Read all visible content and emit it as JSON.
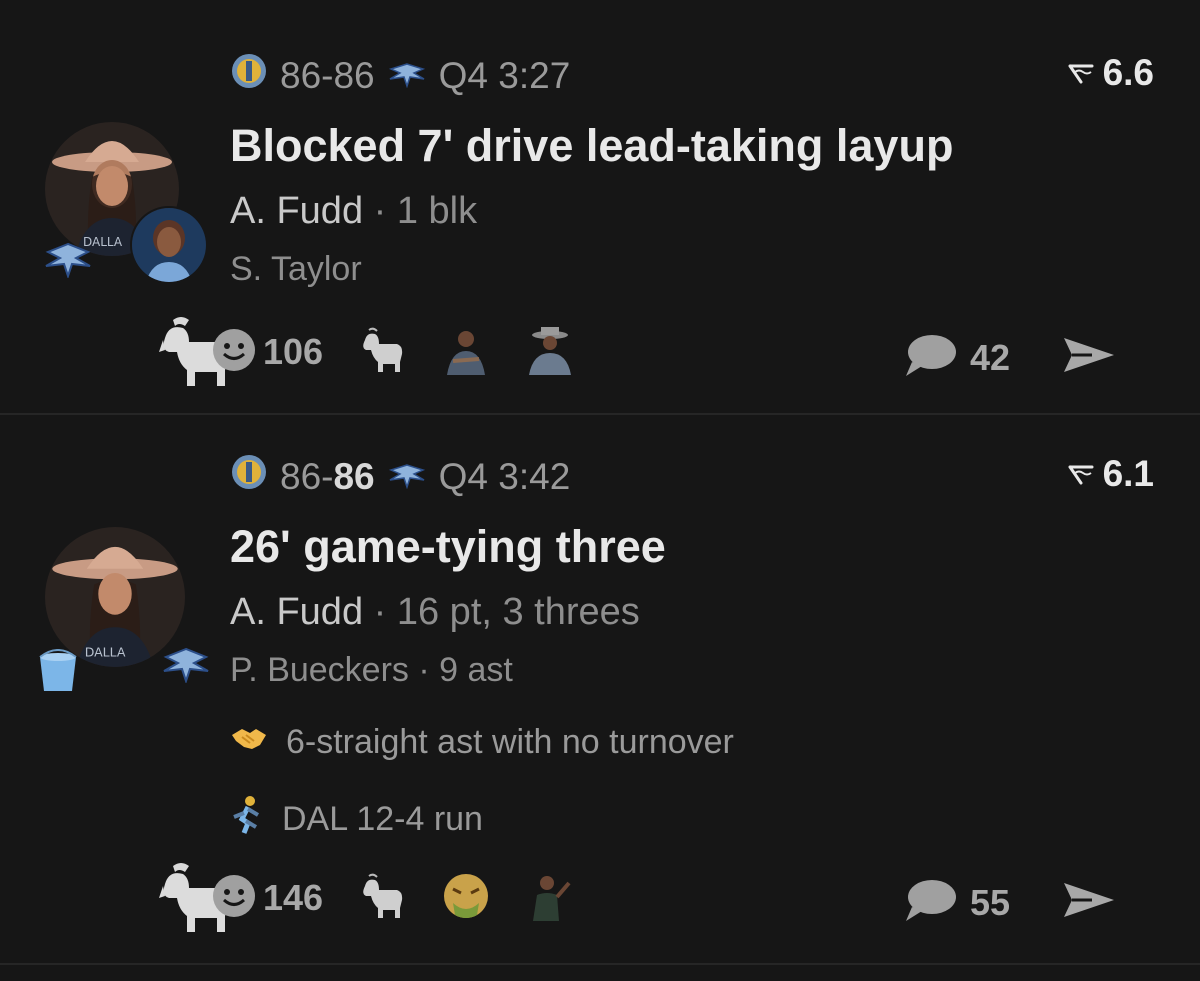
{
  "plays": [
    {
      "score": "86-86",
      "score_bold": "",
      "clock": "Q4 3:27",
      "rating": "6.6",
      "title": "Blocked 7' drive lead-taking layup",
      "primary_player": "A. Fudd",
      "primary_stat": "1 blk",
      "secondary_player": "S. Taylor",
      "secondary_stat": "",
      "tags": [],
      "reaction_count": "106",
      "comment_count": "42"
    },
    {
      "score": "86-",
      "score_bold": "86",
      "clock": "Q4 3:42",
      "rating": "6.1",
      "title": "26' game-tying three",
      "primary_player": "A. Fudd",
      "primary_stat": "16 pt, 3 threes",
      "secondary_player": "P. Bueckers",
      "secondary_stat": "9 ast",
      "tags": [
        {
          "icon": "handshake-icon",
          "text": "6-straight ast with no turnover"
        },
        {
          "icon": "runner-icon",
          "text": "DAL 12-4 run"
        }
      ],
      "reaction_count": "146",
      "comment_count": "55"
    }
  ],
  "separator": "·",
  "icons": {
    "home_team": "basketball-team-logo-icon",
    "away_team": "wings-logo-icon",
    "rating": "tilde-flag-icon",
    "goat": "goat-icon",
    "smiley": "add-reaction-icon",
    "comment": "comment-bubble-icon",
    "share": "send-arrow-icon"
  },
  "colors": {
    "background": "#161616",
    "text_primary": "#e8e8e8",
    "text_secondary": "#8e8e8e",
    "divider": "#262626"
  }
}
